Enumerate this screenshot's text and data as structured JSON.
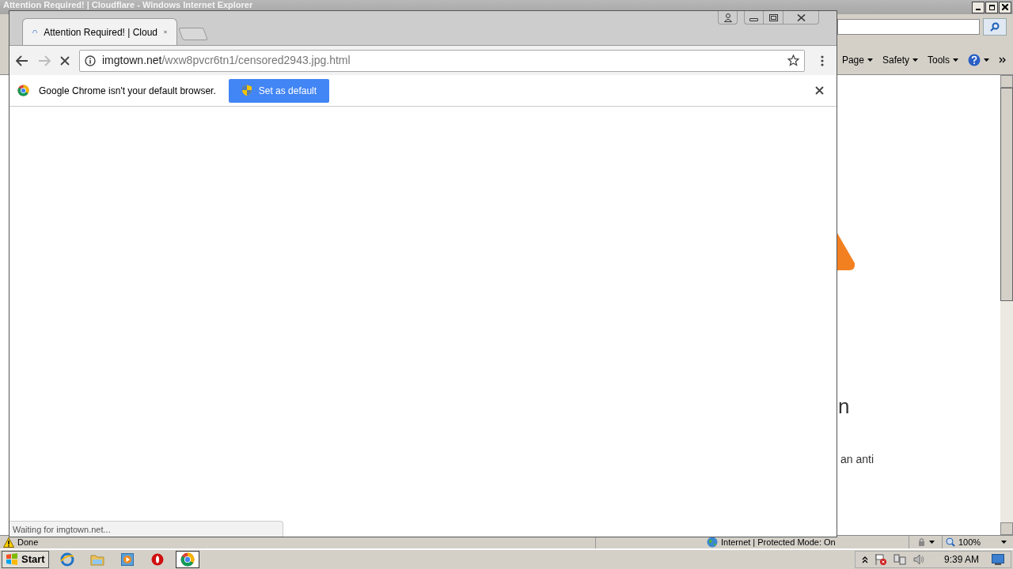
{
  "ie_window": {
    "title": "Attention Required! | Cloudflare - Windows Internet Explorer",
    "command_bar": [
      {
        "label": "Page"
      },
      {
        "label": "Safety"
      },
      {
        "label": "Tools"
      }
    ],
    "page_fragments": [
      "n",
      "an anti"
    ],
    "status": "Done",
    "zone": "Internet | Protected Mode: On",
    "zoom": "100%"
  },
  "chrome_window": {
    "tabs": [
      {
        "title": "Attention Required! | Cloud",
        "selected": true
      }
    ],
    "address": {
      "host": "imgtown.net",
      "path": "/wxw8pvcr6tn1/censored2943.jpg.html"
    },
    "loading": true,
    "infobar": {
      "message": "Google Chrome isn't your default browser.",
      "button": "Set as default"
    },
    "status_bubble": "Waiting for imgtown.net..."
  },
  "taskbar": {
    "start": "Start",
    "apps": [
      {
        "kind": "ie",
        "selected": false
      },
      {
        "kind": "folder",
        "selected": false
      },
      {
        "kind": "media",
        "selected": false
      },
      {
        "kind": "opera",
        "selected": false
      },
      {
        "kind": "chrome",
        "selected": true
      }
    ],
    "clock": "9:39 AM"
  }
}
